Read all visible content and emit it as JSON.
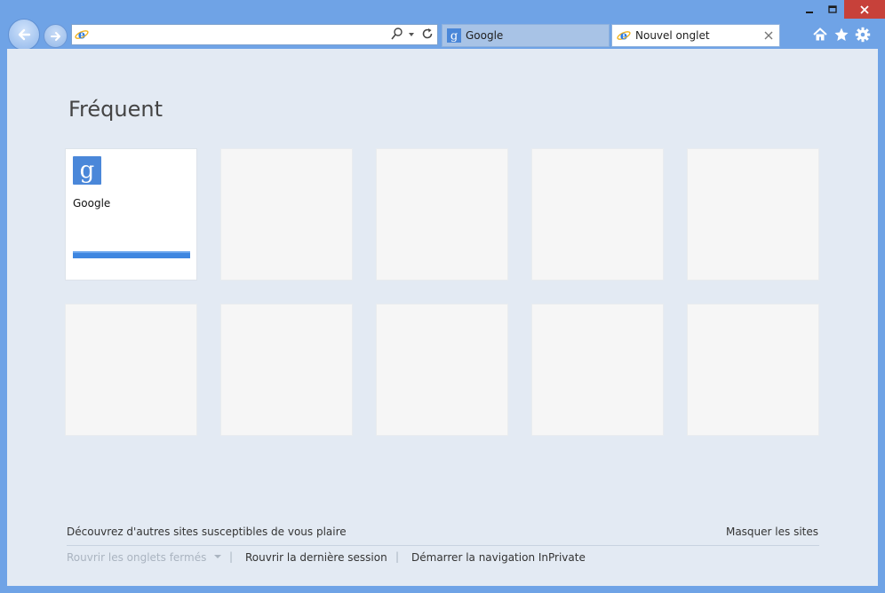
{
  "browser": {
    "address": {
      "value": "",
      "placeholder": ""
    },
    "tabs": [
      {
        "label": "Google",
        "icon": "google-icon"
      },
      {
        "label": "Nouvel onglet",
        "icon": "ie-icon"
      }
    ]
  },
  "content": {
    "heading": "Fréquent",
    "tiles": [
      {
        "label": "Google",
        "icon_letter": "g"
      }
    ],
    "discover_label": "Découvrez d'autres sites susceptibles de vous plaire",
    "hide_sites_label": "Masquer les sites",
    "reopen_closed_tabs_label": "Rouvrir les onglets fermés",
    "reopen_last_session_label": "Rouvrir la dernière session",
    "inprivate_label": "Démarrer la navigation InPrivate",
    "separator": "|"
  },
  "colors": {
    "frame": "#6fa3e6",
    "content_bg": "#e3eaf3",
    "google_blue": "#4a87d9",
    "close_red": "#c7413a"
  }
}
